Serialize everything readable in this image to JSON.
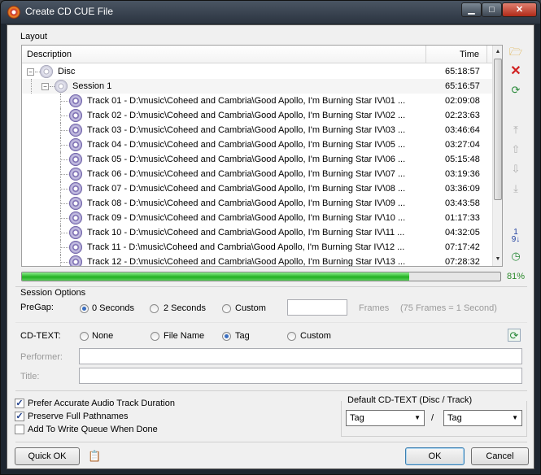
{
  "window": {
    "title": "Create CD CUE File",
    "caption_min": "▁",
    "caption_max": "□",
    "caption_close": "✕"
  },
  "layout": {
    "group_label": "Layout",
    "columns": {
      "description": "Description",
      "time": "Time"
    },
    "disc": {
      "label": "Disc",
      "time": "65:18:57"
    },
    "session": {
      "label": "Session 1",
      "time": "65:16:57"
    },
    "tracks": [
      {
        "label": "Track 01 - D:\\music\\Coheed and Cambria\\Good Apollo, I'm Burning Star IV\\01 ...",
        "time": "02:09:08"
      },
      {
        "label": "Track 02 - D:\\music\\Coheed and Cambria\\Good Apollo, I'm Burning Star IV\\02 ...",
        "time": "02:23:63"
      },
      {
        "label": "Track 03 - D:\\music\\Coheed and Cambria\\Good Apollo, I'm Burning Star IV\\03 ...",
        "time": "03:46:64"
      },
      {
        "label": "Track 04 - D:\\music\\Coheed and Cambria\\Good Apollo, I'm Burning Star IV\\05 ...",
        "time": "03:27:04"
      },
      {
        "label": "Track 05 - D:\\music\\Coheed and Cambria\\Good Apollo, I'm Burning Star IV\\06 ...",
        "time": "05:15:48"
      },
      {
        "label": "Track 06 - D:\\music\\Coheed and Cambria\\Good Apollo, I'm Burning Star IV\\07 ...",
        "time": "03:19:36"
      },
      {
        "label": "Track 07 - D:\\music\\Coheed and Cambria\\Good Apollo, I'm Burning Star IV\\08 ...",
        "time": "03:36:09"
      },
      {
        "label": "Track 08 - D:\\music\\Coheed and Cambria\\Good Apollo, I'm Burning Star IV\\09 ...",
        "time": "03:43:58"
      },
      {
        "label": "Track 09 - D:\\music\\Coheed and Cambria\\Good Apollo, I'm Burning Star IV\\10 ...",
        "time": "01:17:33"
      },
      {
        "label": "Track 10 - D:\\music\\Coheed and Cambria\\Good Apollo, I'm Burning Star IV\\11 ...",
        "time": "04:32:05"
      },
      {
        "label": "Track 11 - D:\\music\\Coheed and Cambria\\Good Apollo, I'm Burning Star IV\\12 ...",
        "time": "07:17:42"
      },
      {
        "label": "Track 12 - D:\\music\\Coheed and Cambria\\Good Apollo, I'm Burning Star IV\\13 ...",
        "time": "07:28:32"
      }
    ],
    "progress_fraction": 0.81,
    "progress_text": "81%"
  },
  "session_options": {
    "group_label": "Session Options",
    "pregap_label": "PreGap:",
    "pregap_options": [
      "0 Seconds",
      "2 Seconds",
      "Custom"
    ],
    "frames_label": "Frames",
    "frames_hint": "(75 Frames = 1 Second)",
    "cdtext_label": "CD-TEXT:",
    "cdtext_options": [
      "None",
      "File Name",
      "Tag",
      "Custom"
    ],
    "cdtext_selected": "Tag",
    "performer_label": "Performer:",
    "title_label": "Title:"
  },
  "options": {
    "prefer_accurate": "Prefer Accurate Audio Track Duration",
    "preserve_paths": "Preserve Full Pathnames",
    "add_to_queue": "Add To Write Queue When Done",
    "default_cdtext_label": "Default CD-TEXT (Disc / Track)",
    "disc_value": "Tag",
    "slash": "/",
    "track_value": "Tag"
  },
  "buttons": {
    "quick_ok": "Quick OK",
    "ok": "OK",
    "cancel": "Cancel"
  },
  "icons": {
    "open": "folder-open-icon",
    "delete": "delete-icon",
    "refresh": "refresh-icon",
    "move_top": "move-top-icon",
    "move_up": "move-up-icon",
    "move_down": "move-down-icon",
    "move_bottom": "move-bottom-icon",
    "sort": "sort-icon",
    "time": "time-icon",
    "cdtext_refresh": "refresh-icon",
    "clipboard": "clipboard-icon"
  },
  "colors": {
    "progress": "#22b022",
    "progress_text": "#2c8a2c",
    "delete": "#d02020"
  }
}
